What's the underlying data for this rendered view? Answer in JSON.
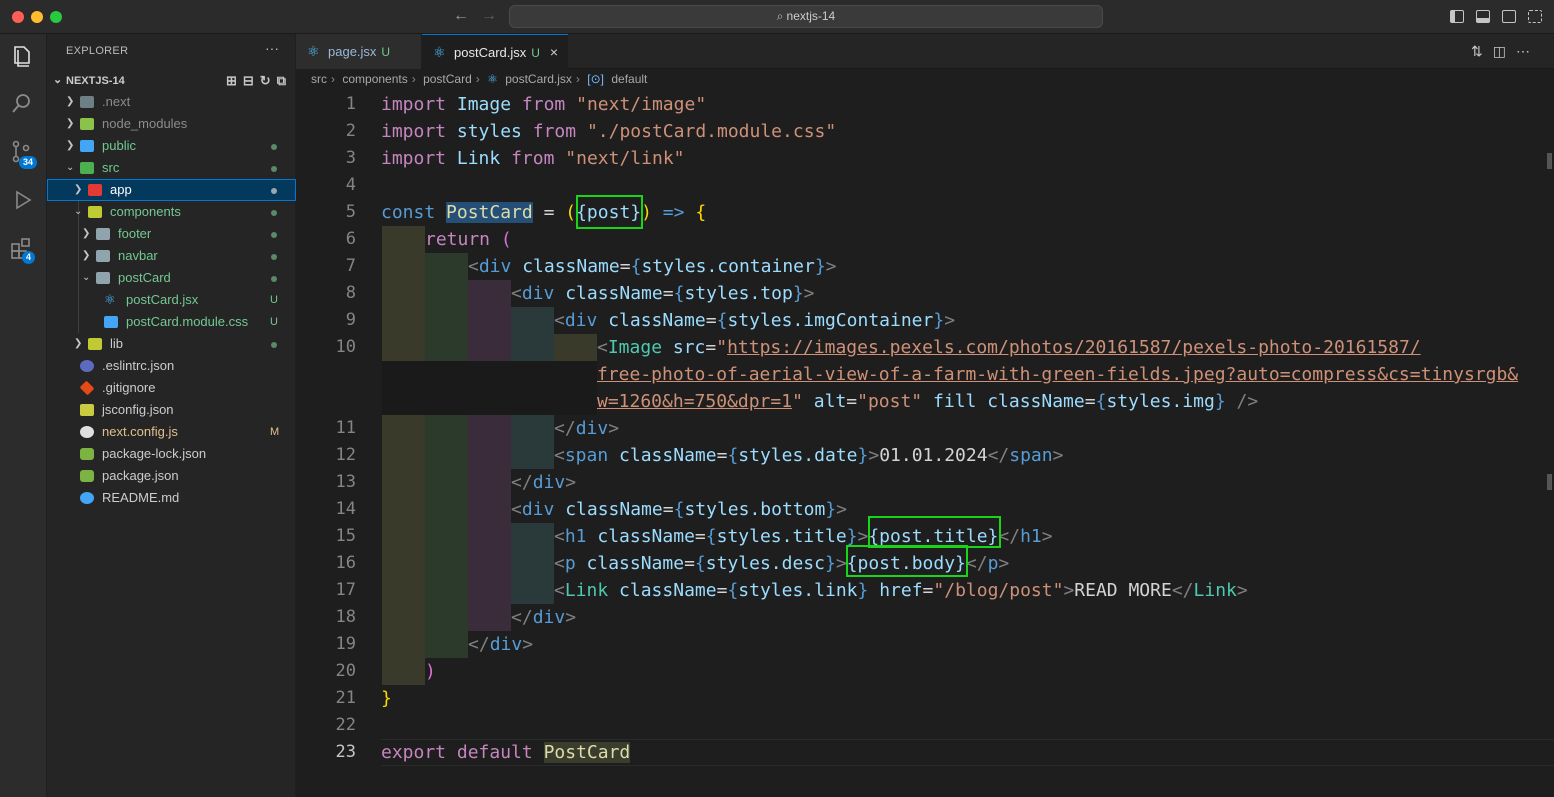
{
  "window": {
    "search_label": "nextjs-14",
    "colors": {
      "accent": "#0078d4",
      "highlight_box": "#19d519",
      "untracked": "#73c991",
      "modified": "#e2c08d"
    }
  },
  "activity_bar": {
    "icons": [
      "files-icon",
      "search-icon",
      "source-control-icon",
      "run-debug-icon",
      "extensions-icon"
    ],
    "source_control_badge": "34",
    "extensions_badge": "4"
  },
  "explorer": {
    "title": "EXPLORER",
    "more_label": "···",
    "root_label": "NEXTJS-14",
    "items": [
      {
        "name": ".next",
        "status": ""
      },
      {
        "name": "node_modules",
        "status": ""
      },
      {
        "name": "public",
        "status": "dot"
      },
      {
        "name": "src",
        "status": "dot"
      },
      {
        "name": "app",
        "status": "dot"
      },
      {
        "name": "components",
        "status": "dot"
      },
      {
        "name": "footer",
        "status": "dot"
      },
      {
        "name": "navbar",
        "status": "dot"
      },
      {
        "name": "postCard",
        "status": "dot"
      },
      {
        "name": "postCard.jsx",
        "status": "U"
      },
      {
        "name": "postCard.module.css",
        "status": "U"
      },
      {
        "name": "lib",
        "status": "dot"
      },
      {
        "name": ".eslintrc.json",
        "status": ""
      },
      {
        "name": ".gitignore",
        "status": ""
      },
      {
        "name": "jsconfig.json",
        "status": ""
      },
      {
        "name": "next.config.js",
        "status": "M"
      },
      {
        "name": "package-lock.json",
        "status": ""
      },
      {
        "name": "package.json",
        "status": ""
      },
      {
        "name": "README.md",
        "status": ""
      }
    ]
  },
  "tabs": [
    {
      "label": "page.jsx",
      "status": "U",
      "active": false
    },
    {
      "label": "postCard.jsx",
      "status": "U",
      "active": true,
      "close": "×"
    }
  ],
  "breadcrumb": [
    "src",
    "components",
    "postCard",
    "postCard.jsx",
    "default"
  ],
  "editor": {
    "line_numbers": [
      "1",
      "2",
      "3",
      "4",
      "5",
      "6",
      "7",
      "8",
      "9",
      "10",
      "11",
      "12",
      "13",
      "14",
      "15",
      "16",
      "17",
      "18",
      "19",
      "20",
      "21",
      "22",
      "23"
    ],
    "current_line": "23",
    "code": {
      "l1": {
        "kw": "import",
        "id": "Image",
        "from": "from",
        "str": "\"next/image\""
      },
      "l2": {
        "kw": "import",
        "id": "styles",
        "from": "from",
        "str": "\"./postCard.module.css\""
      },
      "l3": {
        "kw": "import",
        "id": "Link",
        "from": "from",
        "str": "\"next/link\""
      },
      "l5": {
        "const": "const",
        "name": "PostCard",
        "eq": " = ",
        "open": "(",
        "param": "{post}",
        "close": ")",
        "arrow": " => ",
        "brace": "{"
      },
      "l6": {
        "ret": "return",
        "open": " ("
      },
      "l7": {
        "tag": "div",
        "attr": "className",
        "expr": "styles.container"
      },
      "l8": {
        "tag": "div",
        "attr": "className",
        "expr": "styles.top"
      },
      "l9": {
        "tag": "div",
        "attr": "className",
        "expr": "styles.imgContainer"
      },
      "l10": {
        "tag": "Image",
        "attr": "src",
        "url1": "https://images.pexels.com/photos/20161587/pexels-photo-20161587/",
        "url2": "free-photo-of-aerial-view-of-a-farm-with-green-fields.jpeg?auto=compress&cs=tinysrgb&",
        "url3": "w=1260&h=750&dpr=1",
        "alt_attr": "alt",
        "alt_val": "\"post\"",
        "fill": "fill",
        "cls_attr": "className",
        "cls_expr": "styles.img",
        "end": "/>"
      },
      "l11": {
        "tag": "div"
      },
      "l12": {
        "tag": "span",
        "attr": "className",
        "expr": "styles.date",
        "text": "01.01.2024"
      },
      "l13": {
        "tag": "div"
      },
      "l14": {
        "tag": "div",
        "attr": "className",
        "expr": "styles.bottom"
      },
      "l15": {
        "tag": "h1",
        "attr": "className",
        "expr": "styles.title",
        "content": "{post.title}"
      },
      "l16": {
        "tag": "p",
        "attr": "className",
        "expr": "styles.desc",
        "content": "{post.body}"
      },
      "l17": {
        "tag": "Link",
        "attr": "className",
        "expr": "styles.link",
        "href_attr": "href",
        "href_val": "\"/blog/post\"",
        "text": "READ MORE"
      },
      "l18": {
        "tag": "div"
      },
      "l19": {
        "tag": "div"
      },
      "l20": {
        "paren": ")"
      },
      "l21": {
        "brace": "}"
      },
      "l23": {
        "kw": "export",
        "kw2": "default",
        "name": "PostCard"
      }
    }
  }
}
